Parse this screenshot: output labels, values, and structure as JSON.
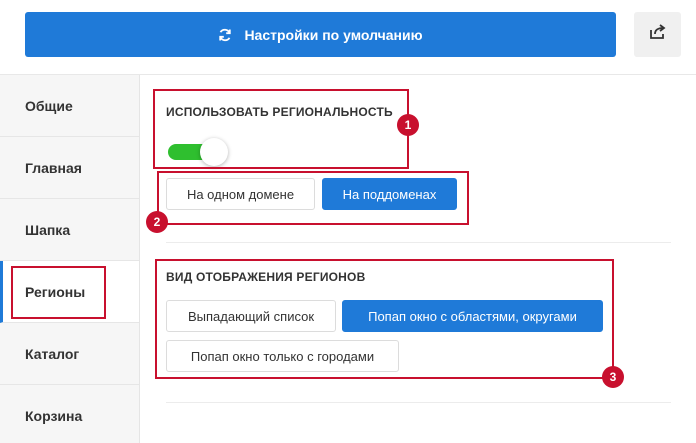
{
  "header": {
    "reset_label": "Настройки по умолчанию",
    "reset_icon": "refresh-icon",
    "share_icon": "share-icon"
  },
  "sidebar": {
    "items": [
      {
        "label": "Общие"
      },
      {
        "label": "Главная"
      },
      {
        "label": "Шапка"
      },
      {
        "label": "Регионы",
        "active": true
      },
      {
        "label": "Каталог"
      },
      {
        "label": "Корзина"
      }
    ]
  },
  "regionality": {
    "label": "ИСПОЛЬЗОВАТЬ РЕГИОНАЛЬНОСТЬ",
    "enabled": true,
    "mode_options": [
      {
        "label": "На одном домене",
        "selected": false
      },
      {
        "label": "На поддоменах",
        "selected": true
      }
    ]
  },
  "display_type": {
    "label": "ВИД ОТОБРАЖЕНИЯ РЕГИОНОВ",
    "options": [
      {
        "label": "Выпадающий список",
        "selected": false
      },
      {
        "label": "Попап окно с областями, округами",
        "selected": true
      },
      {
        "label": "Попап окно только с городами",
        "selected": false
      }
    ]
  },
  "annotations": [
    "1",
    "2",
    "3"
  ],
  "colors": {
    "accent": "#1f7ad8",
    "toggle_on": "#2fbf2f",
    "annotation": "#c8102e"
  }
}
